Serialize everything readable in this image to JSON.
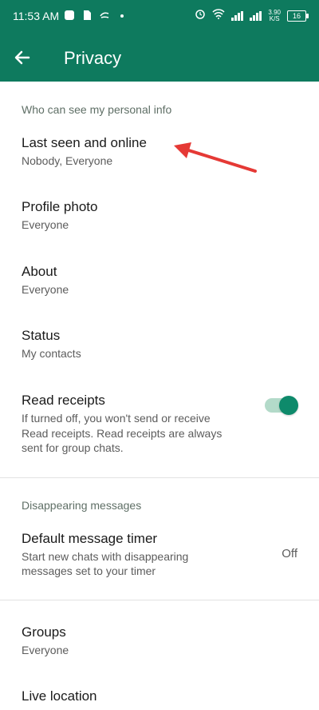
{
  "status_bar": {
    "time": "11:53 AM",
    "net_speed_value": "3.90",
    "net_speed_unit": "K/S",
    "battery": "16"
  },
  "appbar": {
    "title": "Privacy"
  },
  "sections": {
    "personal_info": "Who can see my personal info",
    "disappearing": "Disappearing messages"
  },
  "items": {
    "last_seen": {
      "title": "Last seen and online",
      "sub": "Nobody, Everyone"
    },
    "profile_photo": {
      "title": "Profile photo",
      "sub": "Everyone"
    },
    "about": {
      "title": "About",
      "sub": "Everyone"
    },
    "status": {
      "title": "Status",
      "sub": "My contacts"
    },
    "read_receipts": {
      "title": "Read receipts",
      "sub1": "If turned off, you won't send or receive",
      "sub2": "Read receipts. Read receipts are always",
      "sub3": "sent for group chats.",
      "enabled": true
    },
    "default_timer": {
      "title": "Default message timer",
      "sub1": "Start new chats with disappearing",
      "sub2": "messages set to your timer",
      "value": "Off"
    },
    "groups": {
      "title": "Groups",
      "sub": "Everyone"
    },
    "live_location": {
      "title": "Live location"
    }
  },
  "colors": {
    "accent": "#0e7a5e",
    "toggle_on": "#0e8a6b",
    "annotation_arrow": "#e53935"
  }
}
